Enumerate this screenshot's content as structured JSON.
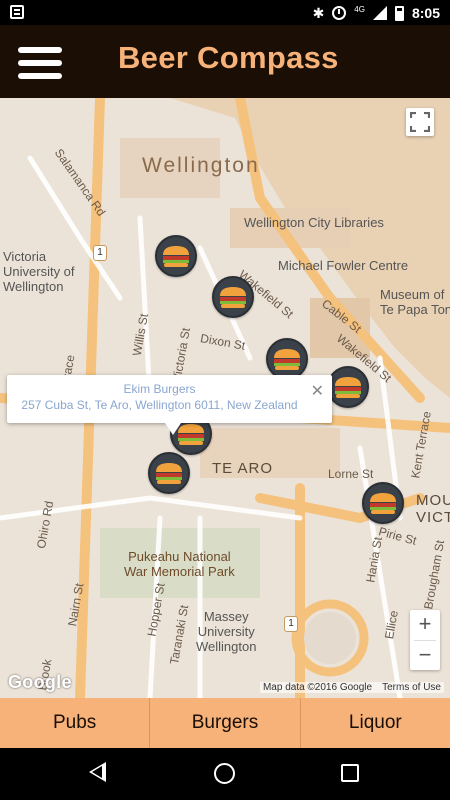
{
  "status_bar": {
    "network": "4G",
    "time": "8:05",
    "icons": [
      "notification-icon",
      "bluetooth-icon",
      "alarm-icon",
      "signal-icon",
      "battery-icon"
    ]
  },
  "app_bar": {
    "title": "Beer Compass",
    "menu_icon": "hamburger-menu-icon"
  },
  "map": {
    "labels": {
      "city": "Wellington",
      "library": "Wellington City Libraries",
      "michael_fowler": "Michael Fowler Centre",
      "museum": "Museum of\nTe Papa Tongarewa",
      "te_aro": "TE ARO",
      "victoria_uni": "Victoria\nUniversity of\nWellington",
      "pukeahu": "Pukeahu National\nWar Memorial Park",
      "massey": "Massey\nUniversity\nWellington",
      "moun_vict": "MOUNT\nVICT",
      "salamanca": "Salamanca Rd",
      "willis": "Willis St",
      "victoria_st": "Victoria St",
      "dixon": "Dixon St",
      "wakefield": "Wakefield St",
      "cable": "Cable St",
      "taranaki": "Taranaki St",
      "lorne": "Lorne St",
      "terrace": "Terrace",
      "ohiro": "Ohiro Rd",
      "nairn": "Nairn St",
      "hopper": "Hopper St",
      "hania": "Hania St",
      "pirie": "Pirie St",
      "brougham": "Brougham St",
      "elli": "Ellice",
      "kent": "Kent Terrace",
      "brook": "Brook"
    },
    "route_markers": [
      "1"
    ],
    "info_window": {
      "title": "Ekim Burgers",
      "address": "257 Cuba St, Te Aro, Wellington 6011, New Zealand",
      "close": "✕"
    },
    "controls": {
      "fullscreen_icon": "fullscreen-icon",
      "zoom_in": "+",
      "zoom_out": "−"
    },
    "google_logo": "Google",
    "attribution": "Map data ©2016 Google",
    "terms": "Terms of Use",
    "pin_icon": "burger-icon"
  },
  "tabs": [
    {
      "label": "Pubs"
    },
    {
      "label": "Burgers"
    },
    {
      "label": "Liquor"
    }
  ],
  "nav_bar": {
    "icons": [
      "back-icon",
      "home-icon",
      "recents-icon"
    ]
  },
  "colors": {
    "accent": "#f7b27a",
    "app_bar": "#1a0e05",
    "pin": "#3b4148",
    "map_bg": "#ece3d8",
    "road": "#f5c27e"
  }
}
